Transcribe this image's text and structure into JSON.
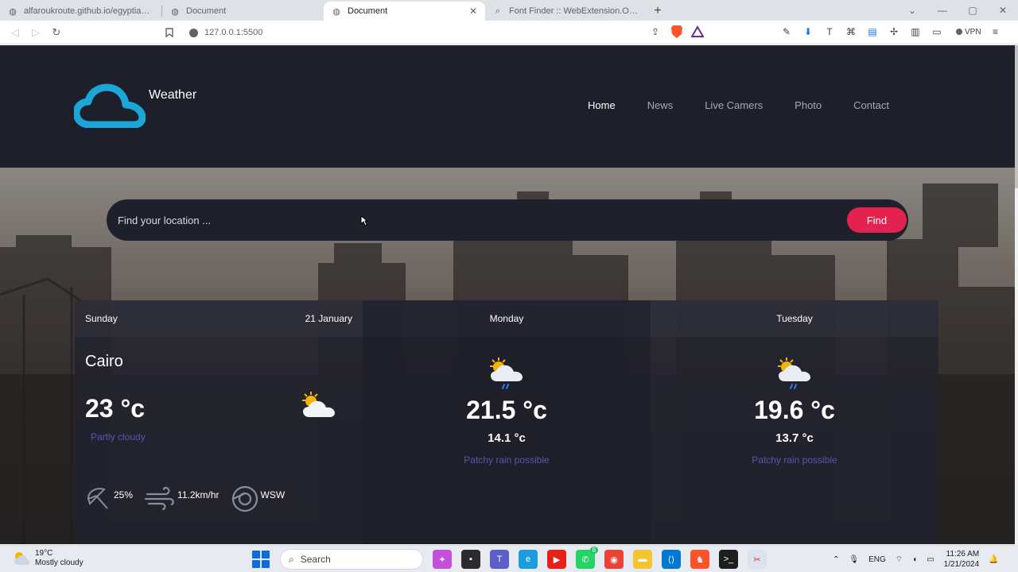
{
  "browser": {
    "tabs": [
      {
        "title": "alfaroukroute.github.io/egyptianParty",
        "icon": "globe-icon",
        "active": false
      },
      {
        "title": "Document",
        "icon": "globe-icon",
        "active": false
      },
      {
        "title": "Document",
        "icon": "globe-icon",
        "active": true
      },
      {
        "title": "Font Finder :: WebExtension.ORG",
        "icon": "search-icon",
        "active": false
      }
    ],
    "url": "127.0.0.1:5500",
    "vpn_label": "VPN"
  },
  "site": {
    "brand": "Weather",
    "nav": [
      "Home",
      "News",
      "Live Camers",
      "Photo",
      "Contact"
    ],
    "active_nav": "Home"
  },
  "search": {
    "placeholder": "Find your location ...",
    "button": "Find"
  },
  "today": {
    "day": "Sunday",
    "date": "21 January",
    "city": "Cairo",
    "temp": "23 °c",
    "condition": "Partly cloudy",
    "icon": "partly-cloudy-icon",
    "humidity": "25%",
    "wind_speed": "11.2km/hr",
    "wind_dir": "WSW"
  },
  "forecast": [
    {
      "day": "Monday",
      "max": "21.5 °c",
      "min": "14.1 °c",
      "condition": "Patchy rain possible",
      "icon": "patchy-rain-icon"
    },
    {
      "day": "Tuesday",
      "max": "19.6 °c",
      "min": "13.7 °c",
      "condition": "Patchy rain possible",
      "icon": "patchy-rain-icon"
    }
  ],
  "colors": {
    "header_bg": "#1d1f2b",
    "accent_button": "#e3224f",
    "logo_cloud": "#1aa7d8",
    "condition_text": "#5a53b5"
  },
  "taskbar": {
    "weather_temp": "19°C",
    "weather_text": "Mostly cloudy",
    "search_label": "Search",
    "language": "ENG",
    "time": "11:26 AM",
    "date": "1/21/2024",
    "whatsapp_badge": "8"
  }
}
